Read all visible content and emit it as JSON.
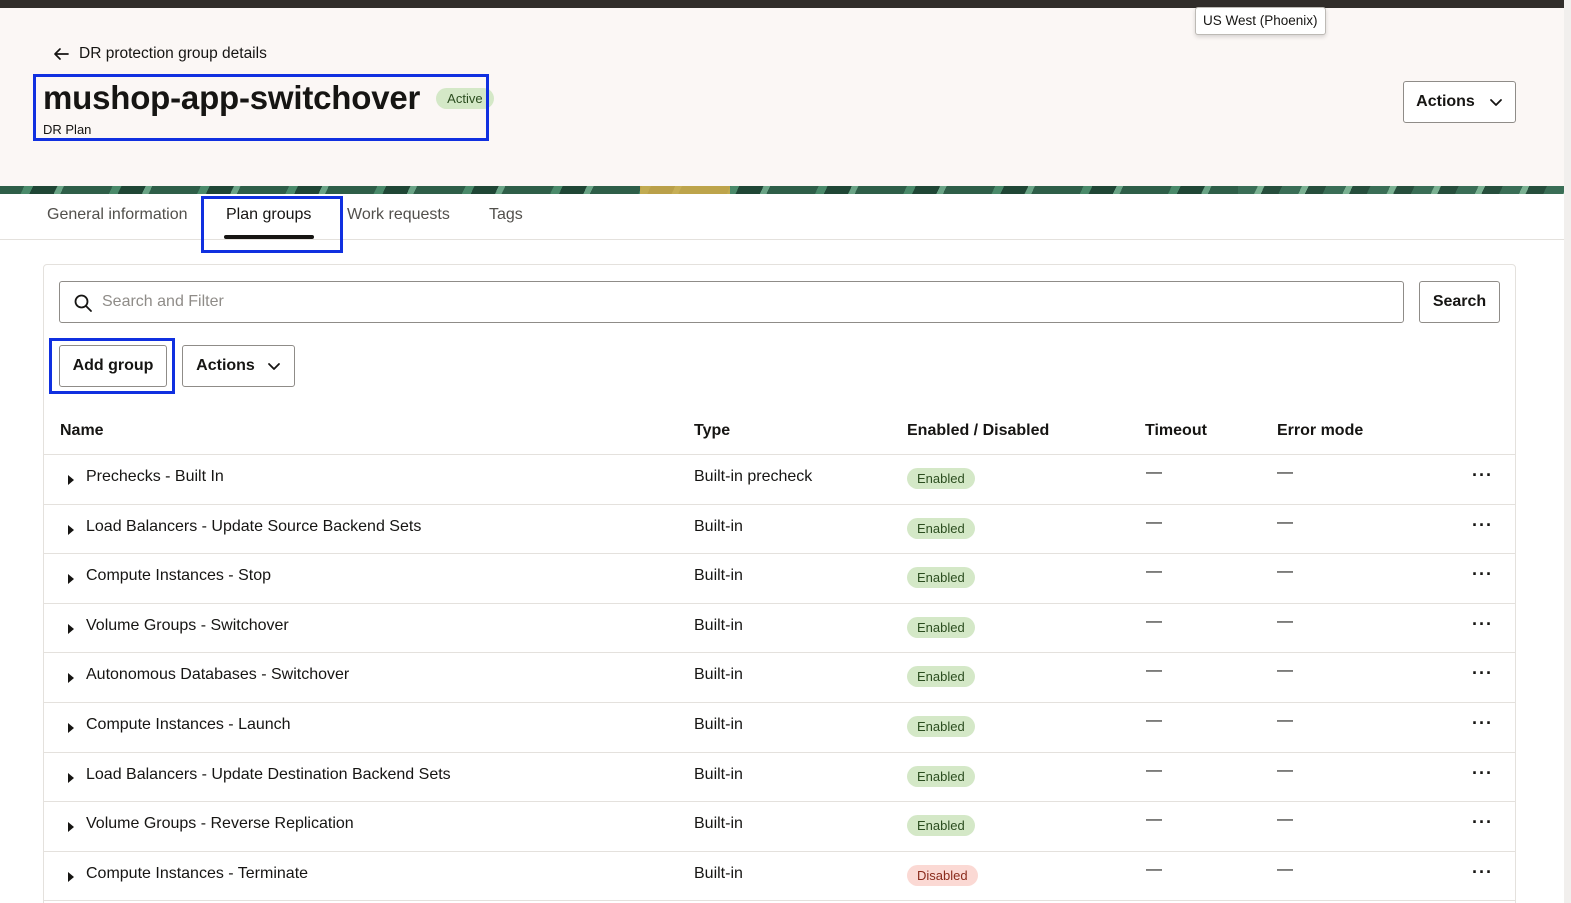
{
  "region_tooltip": "US West (Phoenix)",
  "header": {
    "back_label": "DR protection group details",
    "title": "mushop-app-switchover",
    "status": "Active",
    "subtitle": "DR Plan",
    "actions_label": "Actions"
  },
  "tabs": [
    {
      "label": "General information",
      "active": false
    },
    {
      "label": "Plan groups",
      "active": true
    },
    {
      "label": "Work requests",
      "active": false
    },
    {
      "label": "Tags",
      "active": false
    }
  ],
  "toolbar": {
    "search_placeholder": "Search and Filter",
    "search_button": "Search",
    "add_group_button": "Add group",
    "actions_button": "Actions"
  },
  "table": {
    "columns": [
      "Name",
      "Type",
      "Enabled / Disabled",
      "Timeout",
      "Error mode"
    ],
    "rows": [
      {
        "name": "Prechecks - Built In",
        "type": "Built-in precheck",
        "status": "Enabled",
        "timeout": "—",
        "error_mode": "—"
      },
      {
        "name": "Load Balancers - Update Source Backend Sets",
        "type": "Built-in",
        "status": "Enabled",
        "timeout": "—",
        "error_mode": "—"
      },
      {
        "name": "Compute Instances - Stop",
        "type": "Built-in",
        "status": "Enabled",
        "timeout": "—",
        "error_mode": "—"
      },
      {
        "name": "Volume Groups - Switchover",
        "type": "Built-in",
        "status": "Enabled",
        "timeout": "—",
        "error_mode": "—"
      },
      {
        "name": "Autonomous Databases - Switchover",
        "type": "Built-in",
        "status": "Enabled",
        "timeout": "—",
        "error_mode": "—"
      },
      {
        "name": "Compute Instances - Launch",
        "type": "Built-in",
        "status": "Enabled",
        "timeout": "—",
        "error_mode": "—"
      },
      {
        "name": "Load Balancers - Update Destination Backend Sets",
        "type": "Built-in",
        "status": "Enabled",
        "timeout": "—",
        "error_mode": "—"
      },
      {
        "name": "Volume Groups - Reverse Replication",
        "type": "Built-in",
        "status": "Enabled",
        "timeout": "—",
        "error_mode": "—"
      },
      {
        "name": "Compute Instances - Terminate",
        "type": "Built-in",
        "status": "Disabled",
        "timeout": "—",
        "error_mode": "—"
      }
    ],
    "row_menu_glyph": "···"
  },
  "icons": {
    "back": "arrow-left-icon",
    "search": "search-icon",
    "dropdown": "chevron-down-icon",
    "expand": "caret-right-icon",
    "row_menu": "more-horizontal-icon"
  },
  "colors": {
    "header_bg": "#fbf7f5",
    "enabled_badge": "#d4e8c7",
    "disabled_badge": "#fbd9d4",
    "highlight": "#1030e0"
  }
}
